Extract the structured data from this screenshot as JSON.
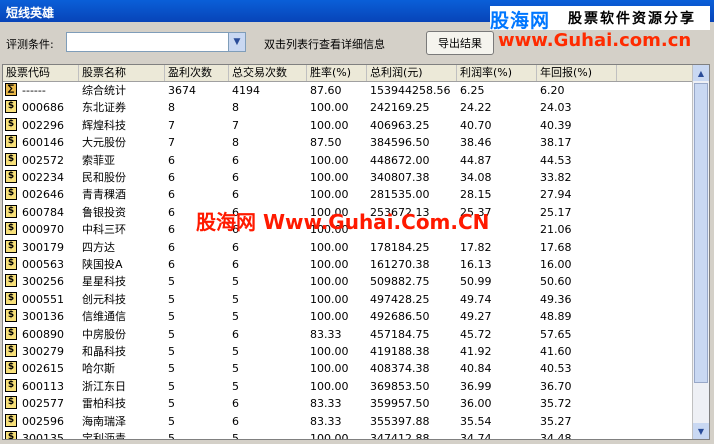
{
  "window": {
    "title": "短线英雄"
  },
  "logo": {
    "brand": "股海网",
    "slogan": "股票软件资源分享",
    "url": "www.Guhai.com.cn"
  },
  "toolbar": {
    "criteria_label": "评测条件:",
    "hint": "双击列表行查看详细信息",
    "export_label": "导出结果"
  },
  "table": {
    "headers": [
      "股票代码",
      "股票名称",
      "盈利次数",
      "总交易次数",
      "胜率(%)",
      "总利润(元)",
      "利润率(%)",
      "年回报(%)"
    ],
    "rows": [
      {
        "icon": "summary",
        "code": "------",
        "name": "综合统计",
        "wins": "3674",
        "trades": "4194",
        "rate": "87.60",
        "profit": "153944258.56",
        "margin": "6.25",
        "annual": "6.20"
      },
      {
        "icon": "stock",
        "code": "000686",
        "name": "东北证券",
        "wins": "8",
        "trades": "8",
        "rate": "100.00",
        "profit": "242169.25",
        "margin": "24.22",
        "annual": "24.03"
      },
      {
        "icon": "stock",
        "code": "002296",
        "name": "辉煌科技",
        "wins": "7",
        "trades": "7",
        "rate": "100.00",
        "profit": "406963.25",
        "margin": "40.70",
        "annual": "40.39"
      },
      {
        "icon": "stock",
        "code": "600146",
        "name": "大元股份",
        "wins": "7",
        "trades": "8",
        "rate": "87.50",
        "profit": "384596.50",
        "margin": "38.46",
        "annual": "38.17"
      },
      {
        "icon": "stock",
        "code": "002572",
        "name": "索菲亚",
        "wins": "6",
        "trades": "6",
        "rate": "100.00",
        "profit": "448672.00",
        "margin": "44.87",
        "annual": "44.53"
      },
      {
        "icon": "stock",
        "code": "002234",
        "name": "民和股份",
        "wins": "6",
        "trades": "6",
        "rate": "100.00",
        "profit": "340807.38",
        "margin": "34.08",
        "annual": "33.82"
      },
      {
        "icon": "stock",
        "code": "002646",
        "name": "青青稞酒",
        "wins": "6",
        "trades": "6",
        "rate": "100.00",
        "profit": "281535.00",
        "margin": "28.15",
        "annual": "27.94"
      },
      {
        "icon": "stock",
        "code": "600784",
        "name": "鲁银投资",
        "wins": "6",
        "trades": "6",
        "rate": "100.00",
        "profit": "253672.13",
        "margin": "25.37",
        "annual": "25.17"
      },
      {
        "icon": "stock",
        "code": "000970",
        "name": "中科三环",
        "wins": "6",
        "trades": "6",
        "rate": "100.00",
        "profit": "",
        "margin": "",
        "annual": "21.06"
      },
      {
        "icon": "stock",
        "code": "300179",
        "name": "四方达",
        "wins": "6",
        "trades": "6",
        "rate": "100.00",
        "profit": "178184.25",
        "margin": "17.82",
        "annual": "17.68"
      },
      {
        "icon": "stock",
        "code": "000563",
        "name": "陕国投A",
        "wins": "6",
        "trades": "6",
        "rate": "100.00",
        "profit": "161270.38",
        "margin": "16.13",
        "annual": "16.00"
      },
      {
        "icon": "stock",
        "code": "300256",
        "name": "星星科技",
        "wins": "5",
        "trades": "5",
        "rate": "100.00",
        "profit": "509882.75",
        "margin": "50.99",
        "annual": "50.60"
      },
      {
        "icon": "stock",
        "code": "000551",
        "name": "创元科技",
        "wins": "5",
        "trades": "5",
        "rate": "100.00",
        "profit": "497428.25",
        "margin": "49.74",
        "annual": "49.36"
      },
      {
        "icon": "stock",
        "code": "300136",
        "name": "信维通信",
        "wins": "5",
        "trades": "5",
        "rate": "100.00",
        "profit": "492686.50",
        "margin": "49.27",
        "annual": "48.89"
      },
      {
        "icon": "stock",
        "code": "600890",
        "name": "中房股份",
        "wins": "5",
        "trades": "6",
        "rate": "83.33",
        "profit": "457184.75",
        "margin": "45.72",
        "annual": "57.65"
      },
      {
        "icon": "stock",
        "code": "300279",
        "name": "和晶科技",
        "wins": "5",
        "trades": "5",
        "rate": "100.00",
        "profit": "419188.38",
        "margin": "41.92",
        "annual": "41.60"
      },
      {
        "icon": "stock",
        "code": "002615",
        "name": "哈尔斯",
        "wins": "5",
        "trades": "5",
        "rate": "100.00",
        "profit": "408374.38",
        "margin": "40.84",
        "annual": "40.53"
      },
      {
        "icon": "stock",
        "code": "600113",
        "name": "浙江东日",
        "wins": "5",
        "trades": "5",
        "rate": "100.00",
        "profit": "369853.50",
        "margin": "36.99",
        "annual": "36.70"
      },
      {
        "icon": "stock",
        "code": "002577",
        "name": "雷柏科技",
        "wins": "5",
        "trades": "6",
        "rate": "83.33",
        "profit": "359957.50",
        "margin": "36.00",
        "annual": "35.72"
      },
      {
        "icon": "stock",
        "code": "002596",
        "name": "海南瑞泽",
        "wins": "5",
        "trades": "6",
        "rate": "83.33",
        "profit": "355397.88",
        "margin": "35.54",
        "annual": "35.27"
      },
      {
        "icon": "stock",
        "code": "300135",
        "name": "宝利沥青",
        "wins": "5",
        "trades": "5",
        "rate": "100.00",
        "profit": "347412.88",
        "margin": "34.74",
        "annual": "34.48"
      }
    ]
  },
  "watermark": "股海网 Www.Guhai.Com.CN"
}
